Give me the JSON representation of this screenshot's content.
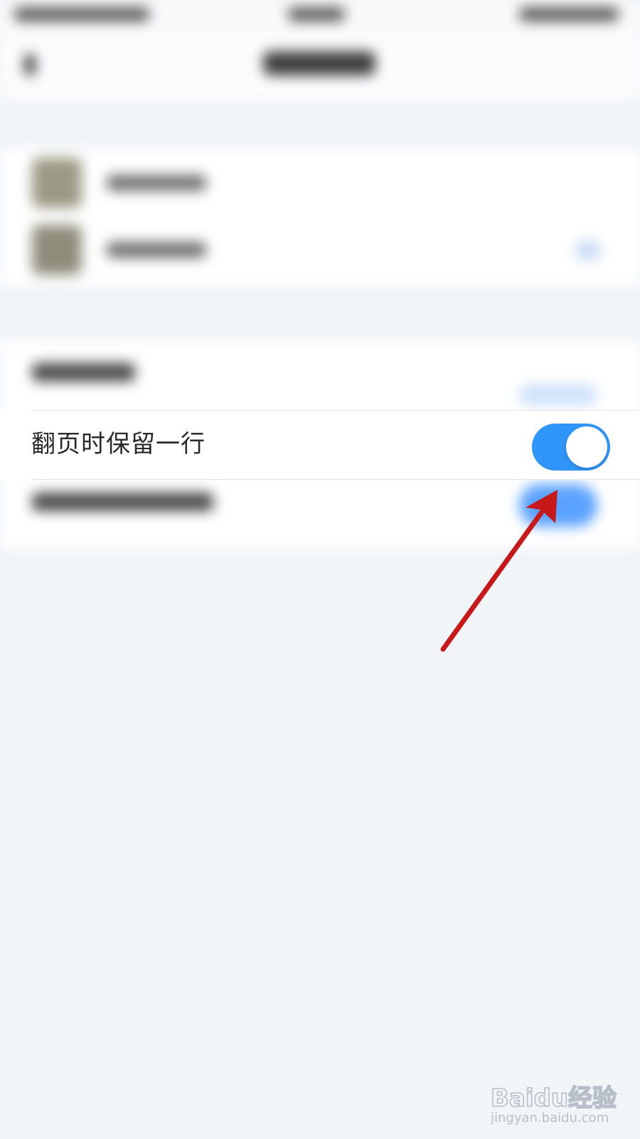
{
  "settings_row": {
    "label": "翻页时保留一行",
    "toggle_on": true
  },
  "colors": {
    "toggle_on": "#3095f8",
    "arrow": "#c8191a"
  },
  "watermark": {
    "logo_text": "Baidu经验",
    "url": "jingyan.baidu.com"
  }
}
